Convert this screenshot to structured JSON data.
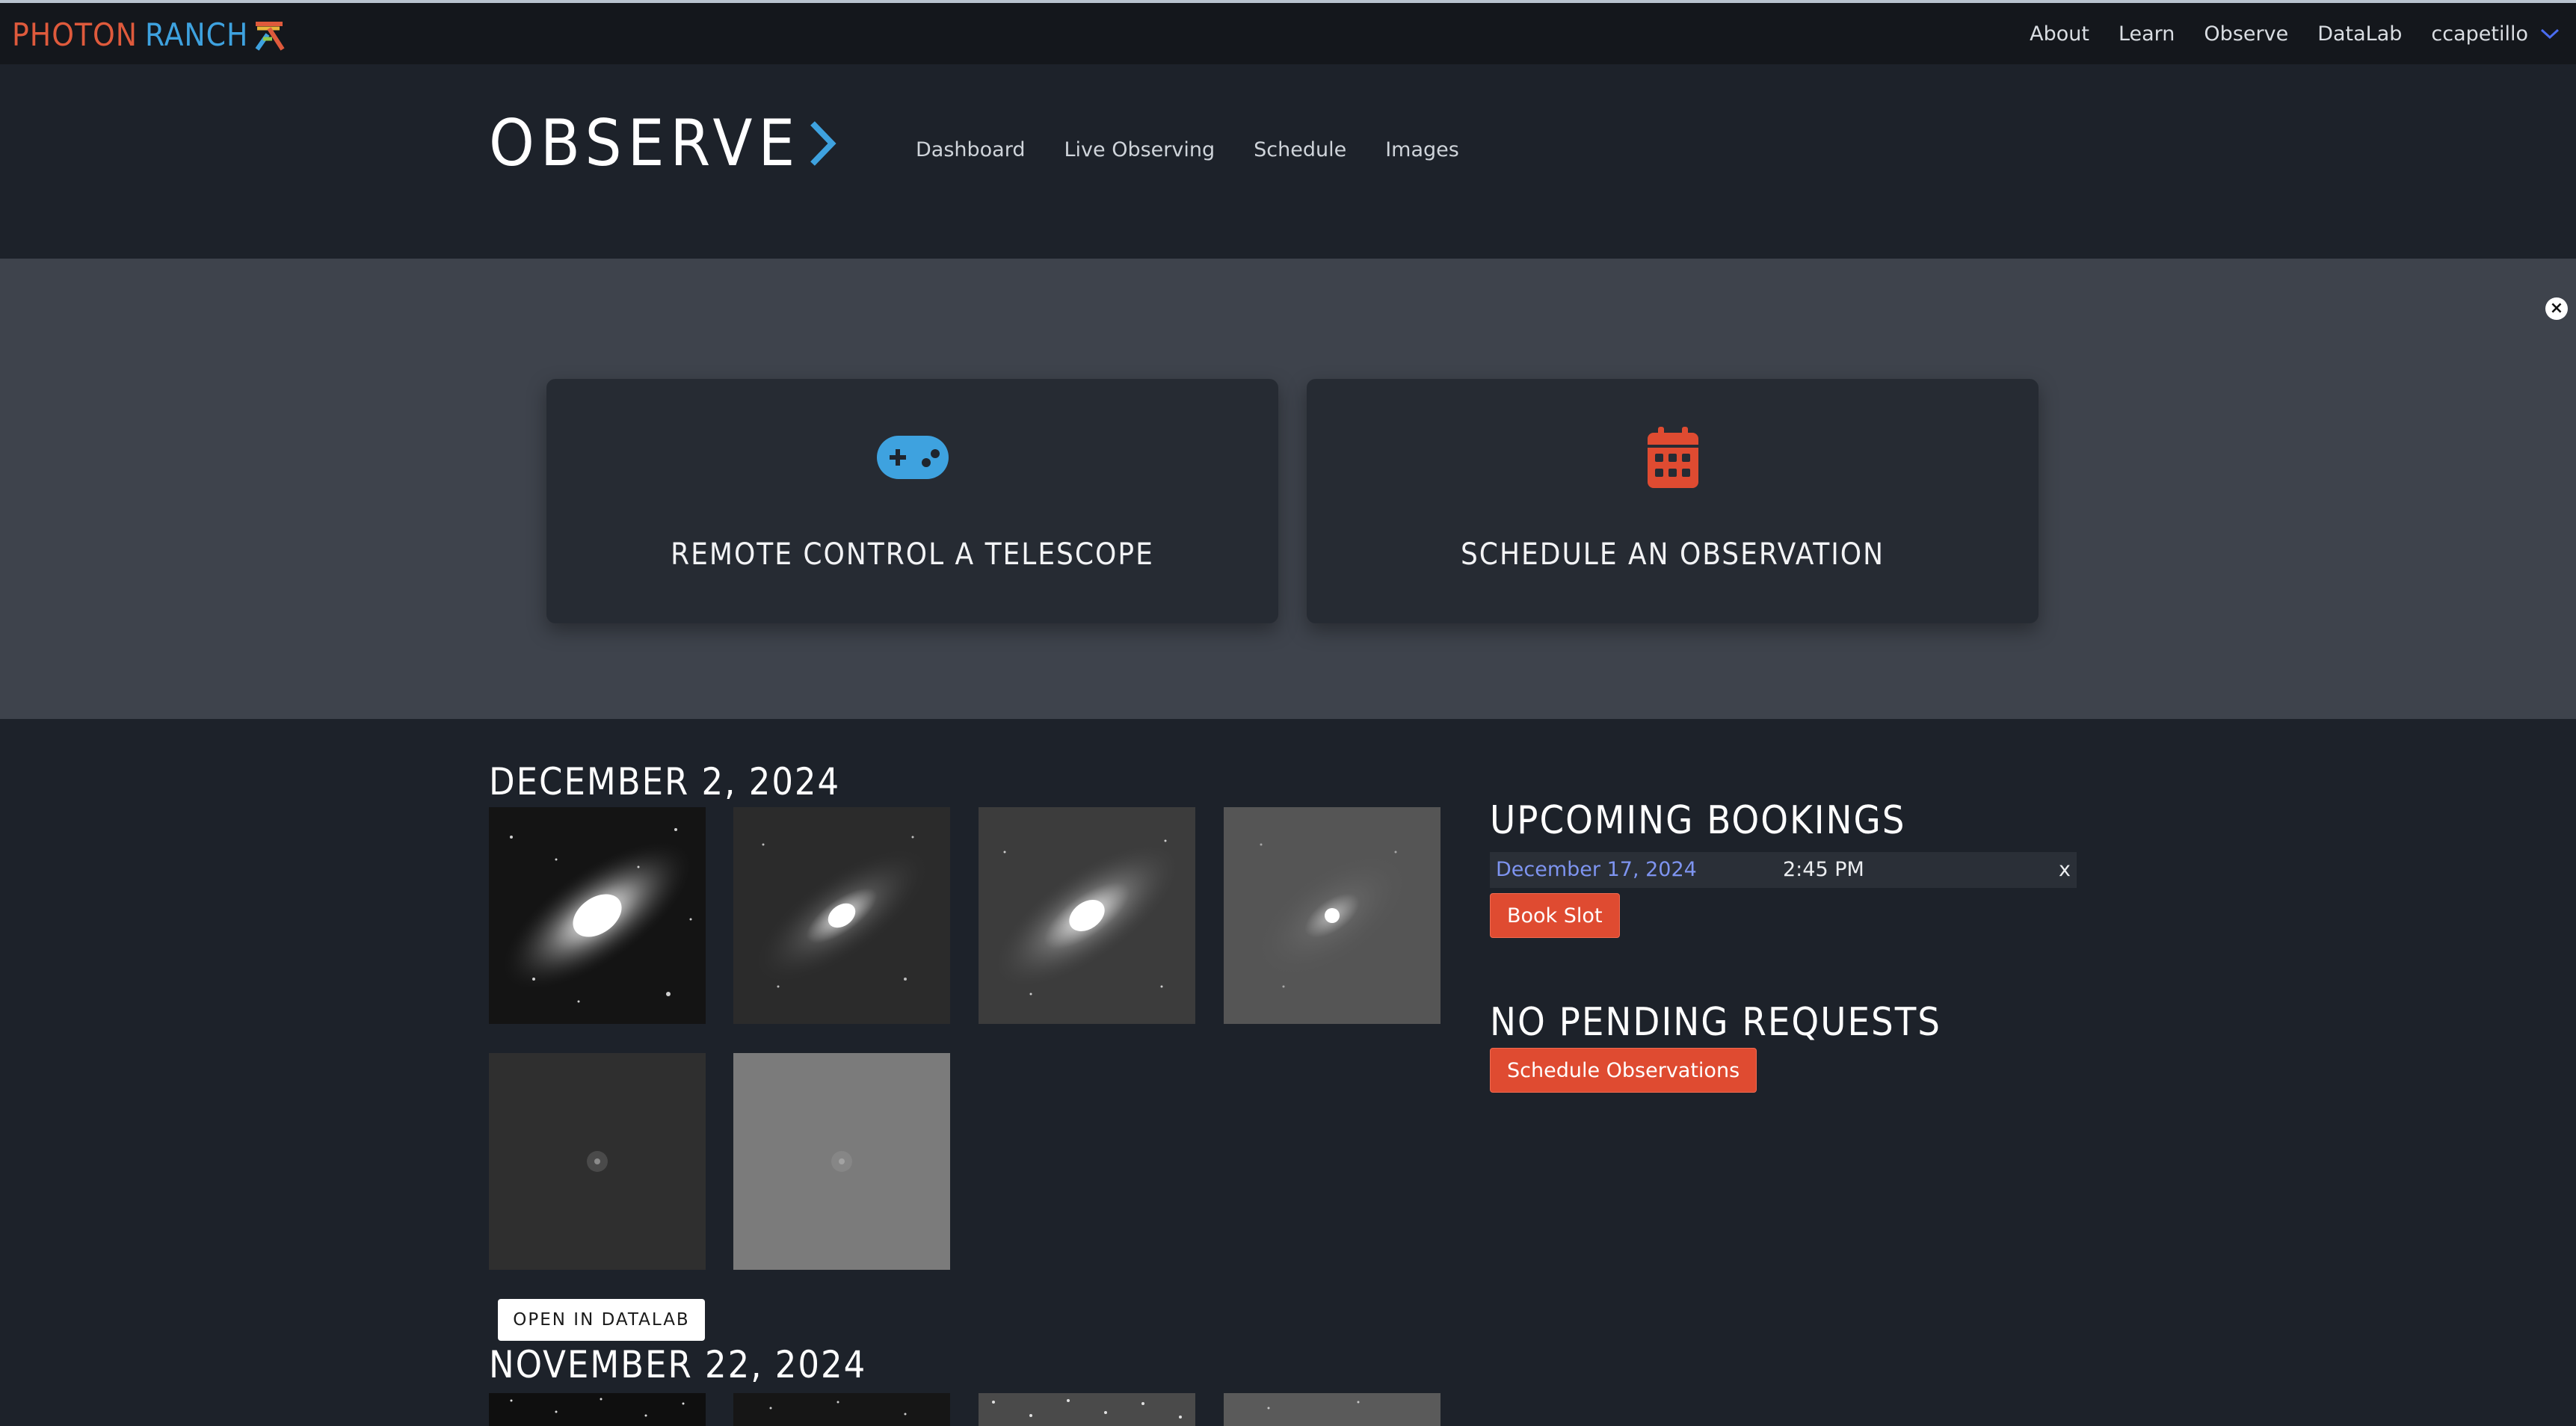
{
  "brand": {
    "part1": "PHOTON",
    "part2": "RANCH"
  },
  "nav": {
    "links": [
      "About",
      "Learn",
      "Observe",
      "DataLab"
    ],
    "user": "ccapetillo"
  },
  "header": {
    "title": "OBSERVE",
    "subnav": [
      "Dashboard",
      "Live Observing",
      "Schedule",
      "Images"
    ]
  },
  "banner": {
    "close": "×",
    "cards": [
      {
        "label": "REMOTE CONTROL A TELESCOPE",
        "icon": "gamepad-icon",
        "color": "#3ea2df"
      },
      {
        "label": "SCHEDULE AN OBSERVATION",
        "icon": "calendar-icon",
        "color": "#df4b31"
      }
    ]
  },
  "sessions": [
    {
      "date": "DECEMBER 2, 2024",
      "button": "OPEN IN DATALAB"
    },
    {
      "date": "NOVEMBER 22, 2024"
    }
  ],
  "bookings": {
    "heading": "UPCOMING BOOKINGS",
    "items": [
      {
        "date": "December 17, 2024",
        "time": "2:45 PM",
        "remove": "x"
      }
    ],
    "book_button": "Book Slot"
  },
  "requests": {
    "heading": "NO PENDING REQUESTS",
    "button": "Schedule Observations"
  },
  "colors": {
    "accent_blue": "#3ea2df",
    "accent_orange": "#df4b31",
    "link_blue": "#7e94f0"
  }
}
